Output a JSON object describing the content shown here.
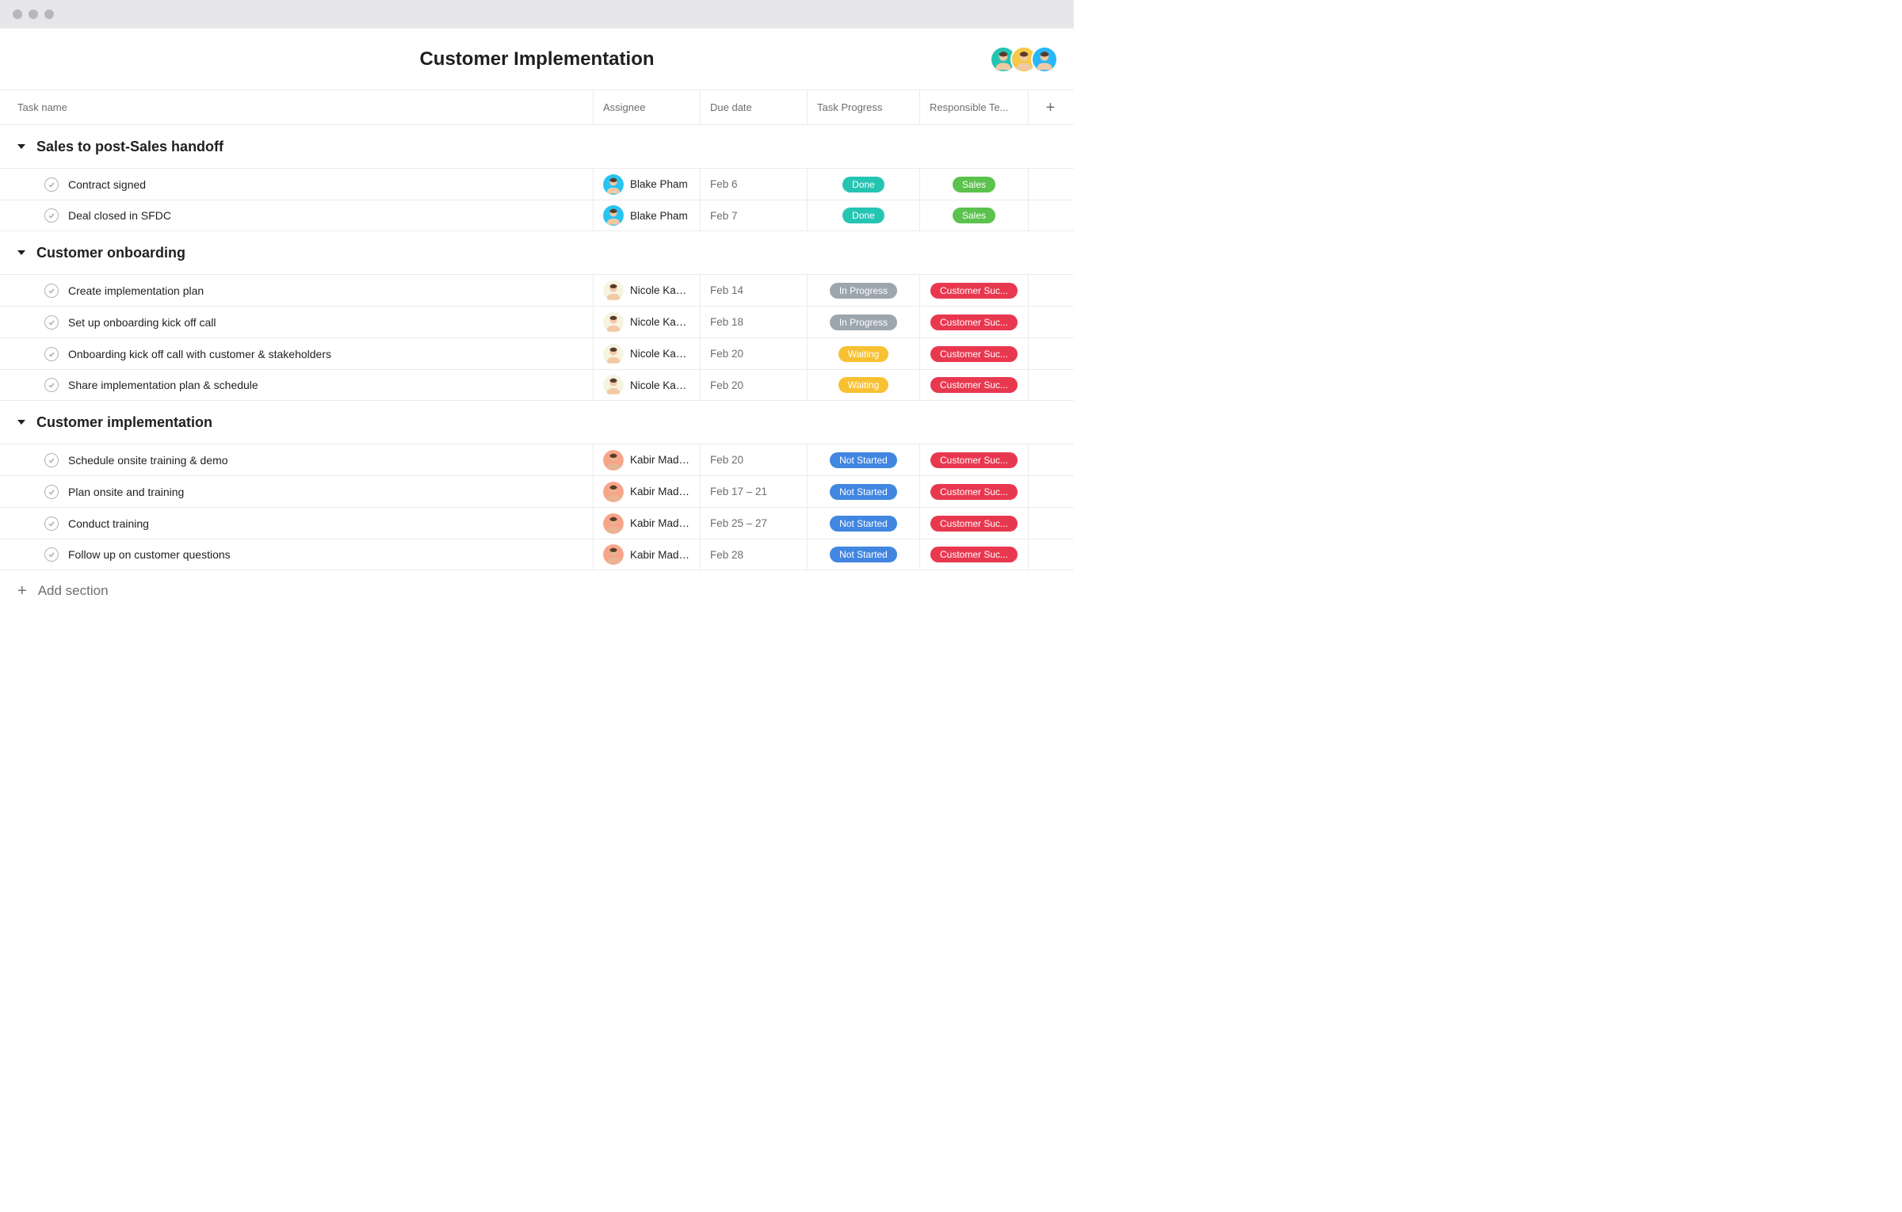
{
  "header": {
    "title": "Customer Implementation",
    "avatars": [
      {
        "bg": "#25c4b3"
      },
      {
        "bg": "#f7c947"
      },
      {
        "bg": "#29b6f6"
      }
    ]
  },
  "columns": {
    "task_name": "Task name",
    "assignee": "Assignee",
    "due_date": "Due date",
    "progress": "Task Progress",
    "team": "Responsible Te..."
  },
  "progress_colors": {
    "Done": "#25c4b3",
    "In Progress": "#9ca6af",
    "Waiting": "#f8c132",
    "Not Started": "#4186e0"
  },
  "team_colors": {
    "Sales": "#5bc24d",
    "Customer Suc...": "#e8384f"
  },
  "assignee_avatars": {
    "Blake Pham": {
      "bg": "#29c4f1",
      "tone": "#f1c9a4"
    },
    "Nicole Kap...": {
      "bg": "#f7f3e1",
      "tone": "#f1c9a4"
    },
    "Kabir Madan": {
      "bg": "#f7a58a",
      "tone": "#e7b591"
    }
  },
  "sections": [
    {
      "title": "Sales to post-Sales handoff",
      "tasks": [
        {
          "name": "Contract signed",
          "assignee": "Blake Pham",
          "due": "Feb 6",
          "progress": "Done",
          "team": "Sales"
        },
        {
          "name": "Deal closed in SFDC",
          "assignee": "Blake Pham",
          "due": "Feb 7",
          "progress": "Done",
          "team": "Sales"
        }
      ]
    },
    {
      "title": "Customer onboarding",
      "tasks": [
        {
          "name": "Create implementation plan",
          "assignee": "Nicole Kap...",
          "due": "Feb 14",
          "progress": "In Progress",
          "team": "Customer Suc..."
        },
        {
          "name": "Set up onboarding kick off call",
          "assignee": "Nicole Kap...",
          "due": "Feb 18",
          "progress": "In Progress",
          "team": "Customer Suc..."
        },
        {
          "name": "Onboarding kick off call with customer & stakeholders",
          "assignee": "Nicole Kap...",
          "due": "Feb 20",
          "progress": "Waiting",
          "team": "Customer Suc..."
        },
        {
          "name": "Share implementation plan & schedule",
          "assignee": "Nicole Kap...",
          "due": "Feb 20",
          "progress": "Waiting",
          "team": "Customer Suc..."
        }
      ]
    },
    {
      "title": "Customer implementation",
      "tasks": [
        {
          "name": "Schedule onsite training & demo",
          "assignee": "Kabir Madan",
          "due": "Feb 20",
          "progress": "Not Started",
          "team": "Customer Suc..."
        },
        {
          "name": "Plan onsite and training",
          "assignee": "Kabir Madan",
          "due": "Feb 17 – 21",
          "progress": "Not Started",
          "team": "Customer Suc..."
        },
        {
          "name": "Conduct training",
          "assignee": "Kabir Madan",
          "due": "Feb 25 – 27",
          "progress": "Not Started",
          "team": "Customer Suc..."
        },
        {
          "name": "Follow up on customer questions",
          "assignee": "Kabir Madan",
          "due": "Feb 28",
          "progress": "Not Started",
          "team": "Customer Suc..."
        }
      ]
    }
  ],
  "footer": {
    "add_section": "Add section"
  }
}
